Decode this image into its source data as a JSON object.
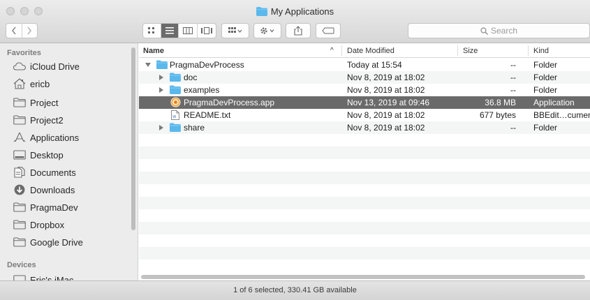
{
  "window": {
    "title": "My Applications",
    "status_text": "1 of 6 selected, 330.41 GB available"
  },
  "toolbar": {
    "back_icon": "chevron-left-icon",
    "forward_icon": "chevron-right-icon",
    "view_modes": [
      "icon-view-icon",
      "list-view-icon",
      "column-view-icon",
      "gallery-view-icon"
    ],
    "active_view": "list-view-icon",
    "group_icon": "group-by-icon",
    "action_icon": "gear-icon",
    "share_icon": "share-icon",
    "tag_icon": "tag-icon",
    "search_placeholder": "Search"
  },
  "sidebar": {
    "sections": [
      {
        "header": "Favorites",
        "items": [
          {
            "label": "iCloud Drive",
            "icon": "cloud-icon"
          },
          {
            "label": "ericb",
            "icon": "home-icon"
          },
          {
            "label": "Project",
            "icon": "folder-icon"
          },
          {
            "label": "Project2",
            "icon": "folder-icon"
          },
          {
            "label": "Applications",
            "icon": "applications-icon"
          },
          {
            "label": "Desktop",
            "icon": "desktop-icon"
          },
          {
            "label": "Documents",
            "icon": "documents-icon"
          },
          {
            "label": "Downloads",
            "icon": "downloads-icon"
          },
          {
            "label": "PragmaDev",
            "icon": "folder-icon"
          },
          {
            "label": "Dropbox",
            "icon": "folder-icon"
          },
          {
            "label": "Google Drive",
            "icon": "folder-icon"
          }
        ]
      },
      {
        "header": "Devices",
        "items": [
          {
            "label": "Eric's iMac",
            "icon": "imac-icon"
          }
        ]
      }
    ]
  },
  "list": {
    "columns": {
      "name": "Name",
      "date": "Date Modified",
      "size": "Size",
      "kind": "Kind"
    },
    "sort_indicator": "^",
    "rows": [
      {
        "name": "PragmaDevProcess",
        "date": "Today at 15:54",
        "size": "--",
        "kind": "Folder",
        "depth": 0,
        "disclosure": "expanded",
        "icon": "folder-icon",
        "selected": false
      },
      {
        "name": "doc",
        "date": "Nov 8, 2019 at 18:02",
        "size": "--",
        "kind": "Folder",
        "depth": 1,
        "disclosure": "collapsed",
        "icon": "folder-icon",
        "selected": false
      },
      {
        "name": "examples",
        "date": "Nov 8, 2019 at 18:02",
        "size": "--",
        "kind": "Folder",
        "depth": 1,
        "disclosure": "collapsed",
        "icon": "folder-icon",
        "selected": false
      },
      {
        "name": "PragmaDevProcess.app",
        "date": "Nov 13, 2019 at 09:46",
        "size": "36.8 MB",
        "kind": "Application",
        "depth": 1,
        "disclosure": "none",
        "icon": "app-icon",
        "selected": true
      },
      {
        "name": "README.txt",
        "date": "Nov 8, 2019 at 18:02",
        "size": "677 bytes",
        "kind": "BBEdit…cument",
        "depth": 1,
        "disclosure": "none",
        "icon": "text-file-icon",
        "selected": false
      },
      {
        "name": "share",
        "date": "Nov 8, 2019 at 18:02",
        "size": "--",
        "kind": "Folder",
        "depth": 1,
        "disclosure": "collapsed",
        "icon": "folder-icon",
        "selected": false
      }
    ]
  },
  "colors": {
    "folder": "#5bb8ec",
    "selection": "#6a6a6a",
    "row_alt": "#f4f5f5"
  }
}
